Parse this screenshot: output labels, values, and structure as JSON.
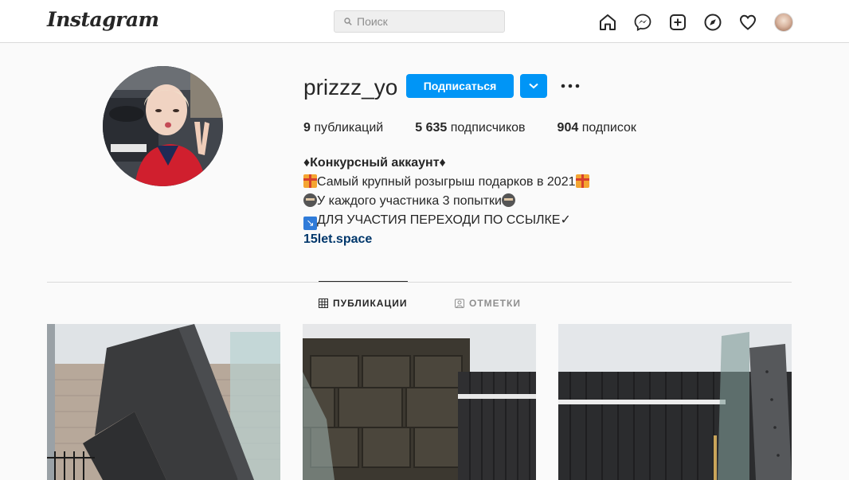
{
  "nav": {
    "logo": "Instagram",
    "search_placeholder": "Поиск",
    "icons": [
      "home-icon",
      "messenger-icon",
      "new-post-icon",
      "explore-icon",
      "activity-heart-icon",
      "profile-avatar"
    ]
  },
  "profile": {
    "username": "prizzz_yo",
    "follow_label": "Подписаться",
    "stats": [
      {
        "count": "9",
        "label": "публикаций"
      },
      {
        "count": "5 635",
        "label": "подписчиков"
      },
      {
        "count": "904",
        "label": "подписок"
      }
    ],
    "bio": {
      "name": "♦Конкурсный аккаунт♦",
      "line1": "Самый крупный розыгрыш подарков в 2021",
      "line2": "У каждого участника 3 попытки",
      "line3": "ДЛЯ УЧАСТИЯ ПЕРЕХОДИ ПО ССЫЛКЕ✓",
      "link": "15let.space"
    }
  },
  "tabs": [
    {
      "label": "ПУБЛИКАЦИИ",
      "active": true
    },
    {
      "label": "ОТМЕТКИ",
      "active": false
    }
  ],
  "colors": {
    "accent": "#0095f6",
    "link": "#00376b",
    "border": "#dbdbdb",
    "background": "#fafafa"
  }
}
